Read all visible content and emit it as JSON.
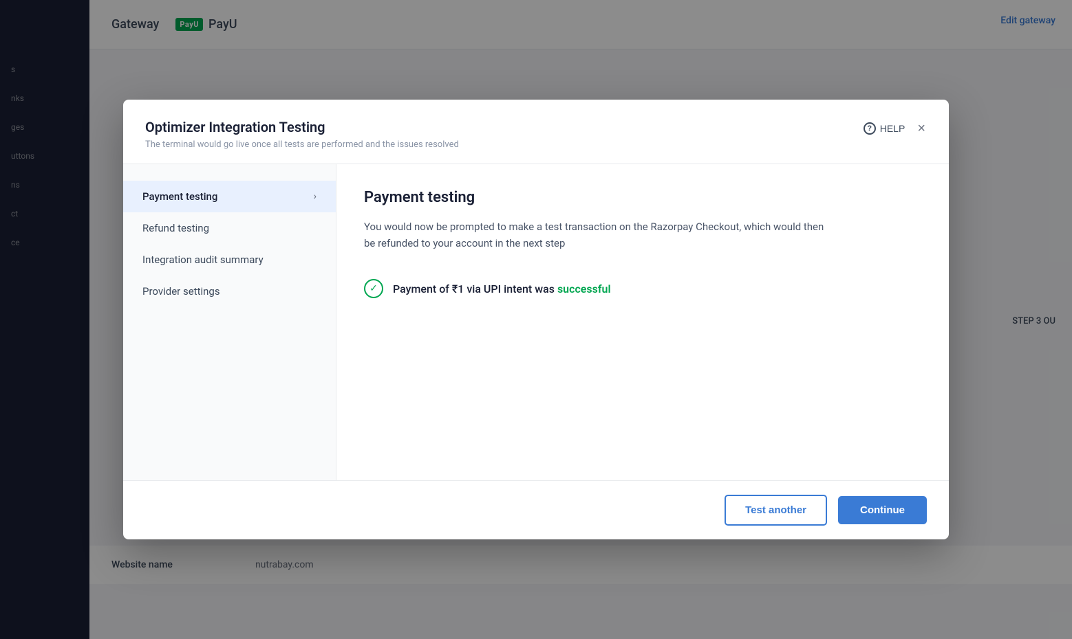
{
  "background": {
    "topbar": {
      "gateway_label": "Gateway",
      "payu_label": "PayU",
      "payu_badge": "PayU",
      "edit_gateway": "Edit gateway"
    },
    "sidebar": {
      "items": [
        "s",
        "nks",
        "ges",
        "uttons",
        "ns",
        "ct",
        "ce"
      ]
    },
    "step_indicator": "STEP 3 OU",
    "website": {
      "label": "Website name",
      "value": "nutrabay.com"
    }
  },
  "modal": {
    "title": "Optimizer Integration Testing",
    "subtitle": "The terminal would go live once all tests are performed and the issues resolved",
    "help_label": "HELP",
    "close_label": "×",
    "nav": {
      "items": [
        {
          "label": "Payment testing",
          "active": true
        },
        {
          "label": "Refund testing",
          "active": false
        },
        {
          "label": "Integration audit summary",
          "active": false
        },
        {
          "label": "Provider settings",
          "active": false
        }
      ]
    },
    "content": {
      "title": "Payment testing",
      "description": "You would now be prompted to make a test transaction on the Razorpay Checkout, which would then be refunded to your account in the next step",
      "success_message_prefix": "Payment of ₹1 via UPI intent was",
      "success_word": "successful"
    },
    "footer": {
      "test_another_label": "Test another",
      "continue_label": "Continue"
    }
  }
}
